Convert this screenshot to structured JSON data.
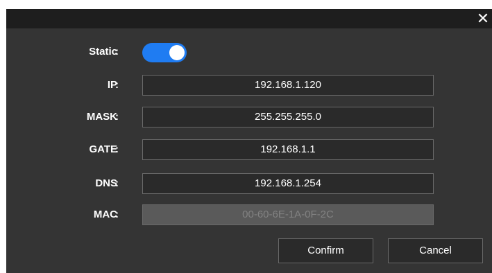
{
  "dialog": {
    "close_icon": "close-icon",
    "close_glyph": "✕"
  },
  "static_row": {
    "label": "Static",
    "colon": ":",
    "enabled": true,
    "accent_color": "#1f7cf2"
  },
  "fields": [
    {
      "label": "IP",
      "colon": ":",
      "value": "192.168.1.120"
    },
    {
      "label": "MASK",
      "colon": ":",
      "value": "255.255.255.0"
    },
    {
      "label": "GATE",
      "colon": ":",
      "value": "192.168.1.1"
    },
    {
      "label": "DNS",
      "colon": ":",
      "value": "192.168.1.254"
    },
    {
      "label": "MAC",
      "colon": ":",
      "value": "00-60-6E-1A-0F-2C"
    }
  ],
  "buttons": {
    "confirm_label": "Confirm",
    "cancel_label": "Cancel"
  }
}
